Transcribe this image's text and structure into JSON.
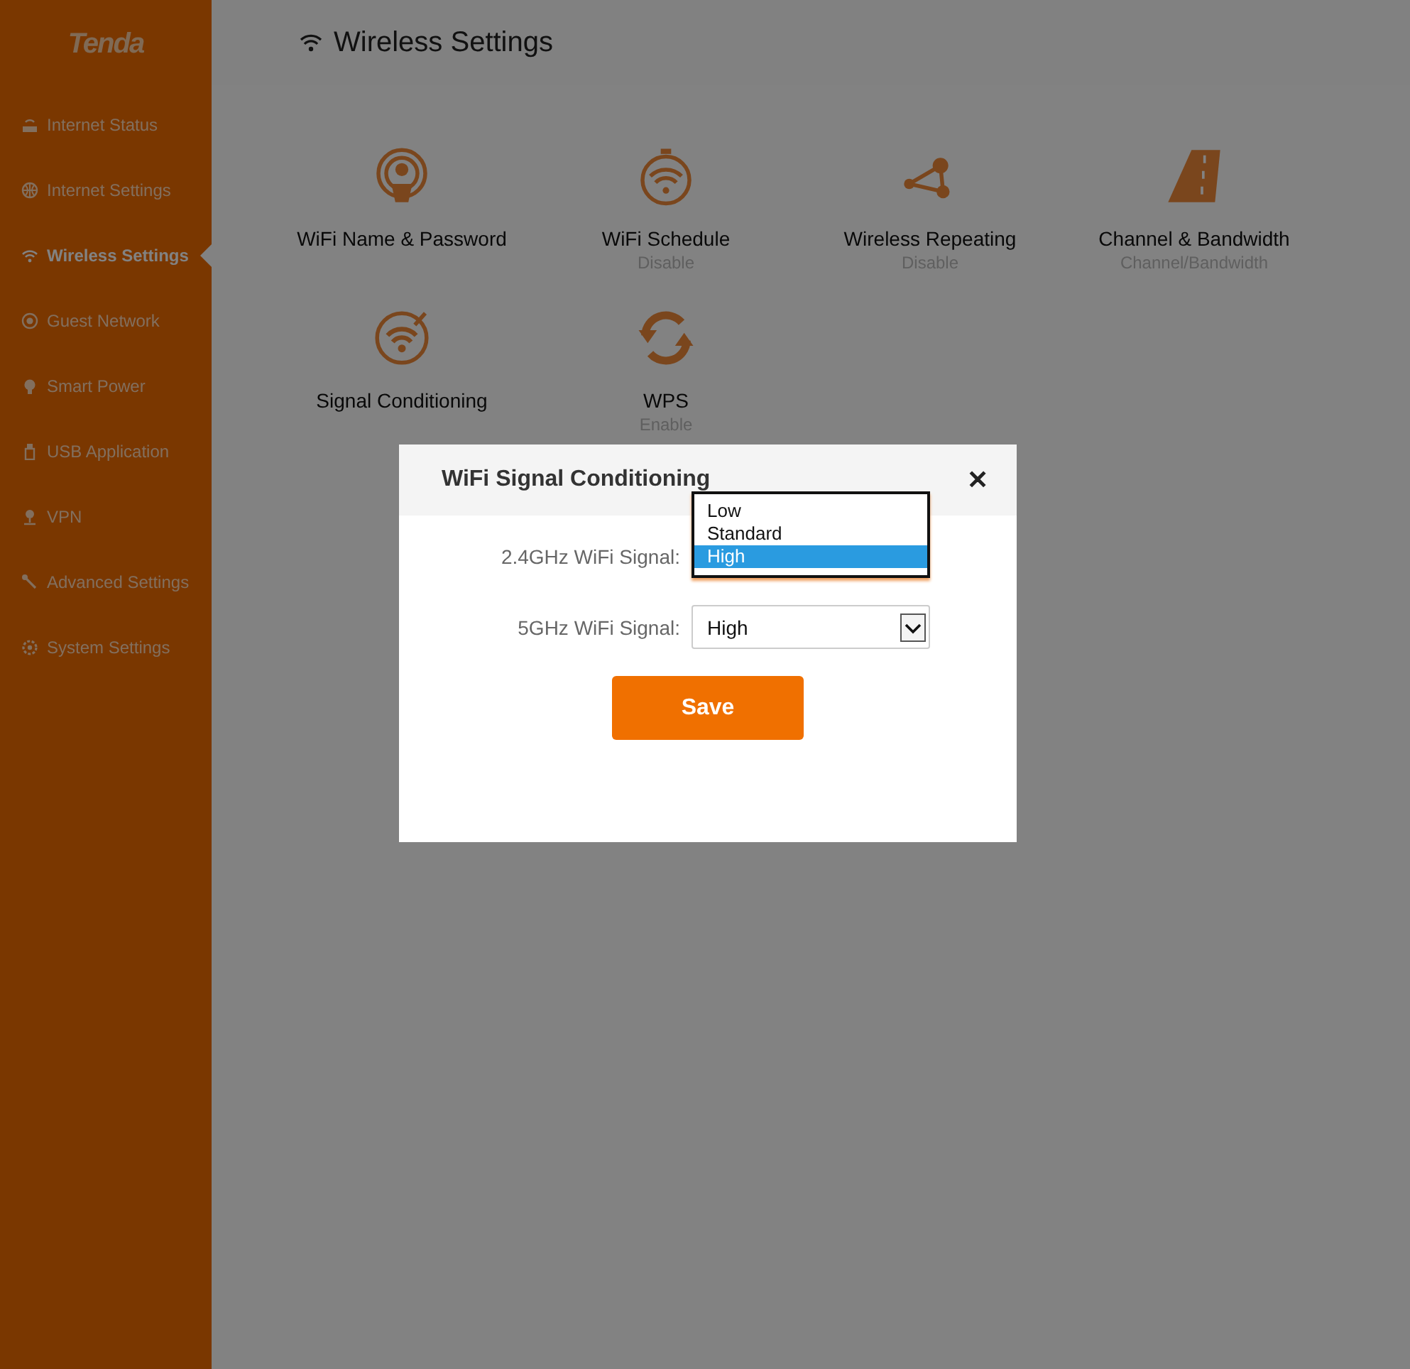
{
  "logo": "Tenda",
  "sidebar": {
    "items": [
      {
        "label": "Internet Status",
        "selected": false
      },
      {
        "label": "Internet Settings",
        "selected": false
      },
      {
        "label": "Wireless Settings",
        "selected": true
      },
      {
        "label": "Guest Network",
        "selected": false
      },
      {
        "label": "Smart Power",
        "selected": false
      },
      {
        "label": "USB Application",
        "selected": false
      },
      {
        "label": "VPN",
        "selected": false
      },
      {
        "label": "Advanced Settings",
        "selected": false
      },
      {
        "label": "System Settings",
        "selected": false
      }
    ]
  },
  "header": {
    "title": "Wireless Settings"
  },
  "tiles": [
    {
      "title": "WiFi Name & Password"
    },
    {
      "title": "WiFi Schedule",
      "subtitle": "Disable"
    },
    {
      "title": "Wireless Repeating",
      "subtitle": "Disable"
    },
    {
      "title": "Channel & Bandwidth",
      "subtitle": "Channel/Bandwidth"
    },
    {
      "title": "Signal Conditioning"
    },
    {
      "title": "WPS",
      "subtitle": "Enable"
    }
  ],
  "dialog": {
    "title": "WiFi Signal Conditioning",
    "close": "✕",
    "fields": [
      {
        "label": "2.4GHz WiFi Signal:",
        "expanded": true,
        "options": [
          {
            "label": "Low",
            "selected": false
          },
          {
            "label": "Standard",
            "selected": false
          },
          {
            "label": "High",
            "selected": true
          }
        ]
      },
      {
        "label": "5GHz WiFi Signal:",
        "expanded": false,
        "value": "High"
      }
    ],
    "save": "Save"
  }
}
